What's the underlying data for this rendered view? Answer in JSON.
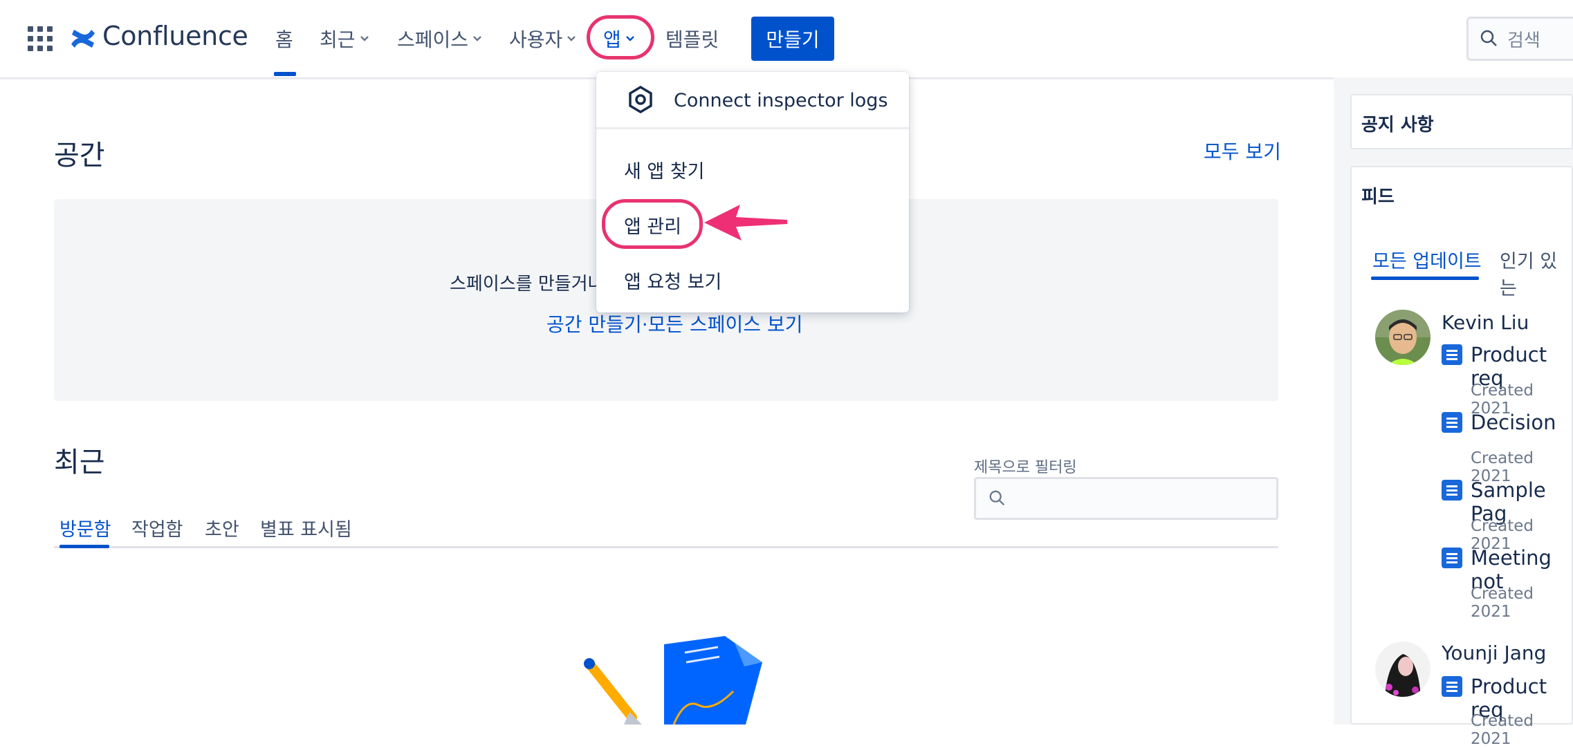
{
  "app": {
    "name": "Confluence"
  },
  "nav": {
    "home": "홈",
    "recent": "최근",
    "spaces": "스페이스",
    "people": "사용자",
    "apps": "앱",
    "templates": "템플릿",
    "create": "만들기",
    "search_placeholder": "검색"
  },
  "apps_menu": {
    "connect_logs": "Connect inspector logs",
    "find_new": "새 앱 찾기",
    "manage": "앱 관리",
    "requests": "앱 요청 보기"
  },
  "spaces_section": {
    "title": "공간",
    "see_all": "모두 보기",
    "empty_message": "스페이스를 만들거나",
    "links": "공간 만들기·모든 스페이스 보기"
  },
  "recent_section": {
    "title": "최근",
    "filter_label": "제목으로 필터링",
    "tabs": [
      "방문함",
      "작업함",
      "초안",
      "별표 표시됨"
    ]
  },
  "sidebar": {
    "announcements_title": "공지 사항",
    "feed_title": "피드",
    "feed_tabs": [
      "모든 업데이트",
      "인기 있는"
    ],
    "feed": [
      {
        "user": "Kevin Liu",
        "items": [
          {
            "title": "Product req",
            "meta": "Created 2021"
          },
          {
            "title": "Decision",
            "meta": "Created 2021"
          },
          {
            "title": "Sample Pag",
            "meta": "Created 2021"
          },
          {
            "title": "Meeting not",
            "meta": "Created 2021"
          }
        ]
      },
      {
        "user": "Younji Jang",
        "items": [
          {
            "title": "Product req",
            "meta": "Created 2021"
          }
        ]
      }
    ]
  },
  "colors": {
    "brand": "#0052cc",
    "highlight": "#e8336e",
    "text": "#172b4d",
    "muted": "#6b778c"
  },
  "icons": [
    "app-switcher-icon",
    "confluence-logo-icon",
    "chevron-down-icon",
    "search-icon",
    "connect-logs-icon",
    "page-icon",
    "pointer-arrow-icon"
  ]
}
